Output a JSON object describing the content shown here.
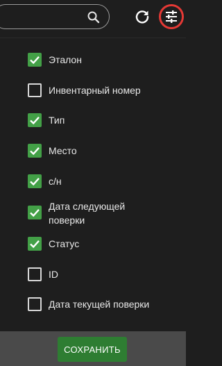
{
  "search": {
    "icon": "search-icon"
  },
  "toolbar": {
    "refresh_icon": "refresh-icon",
    "settings_icon": "tune-icon",
    "settings_highlight_color": "#e53935"
  },
  "columns": [
    {
      "label": "Эталон",
      "checked": true
    },
    {
      "label": "Инвентарный номер",
      "checked": false
    },
    {
      "label": "Тип",
      "checked": true
    },
    {
      "label": "Место",
      "checked": true
    },
    {
      "label": "с/н",
      "checked": true
    },
    {
      "label": "Дата следующей поверки",
      "checked": true
    },
    {
      "label": "Статус",
      "checked": true
    },
    {
      "label": "ID",
      "checked": false
    },
    {
      "label": "Дата текущей поверки",
      "checked": false
    }
  ],
  "footer": {
    "save_label": "СОХРАНИТЬ"
  },
  "colors": {
    "checked": "#43a047",
    "save_button": "#2e7d32",
    "background": "#1e1e1e"
  }
}
